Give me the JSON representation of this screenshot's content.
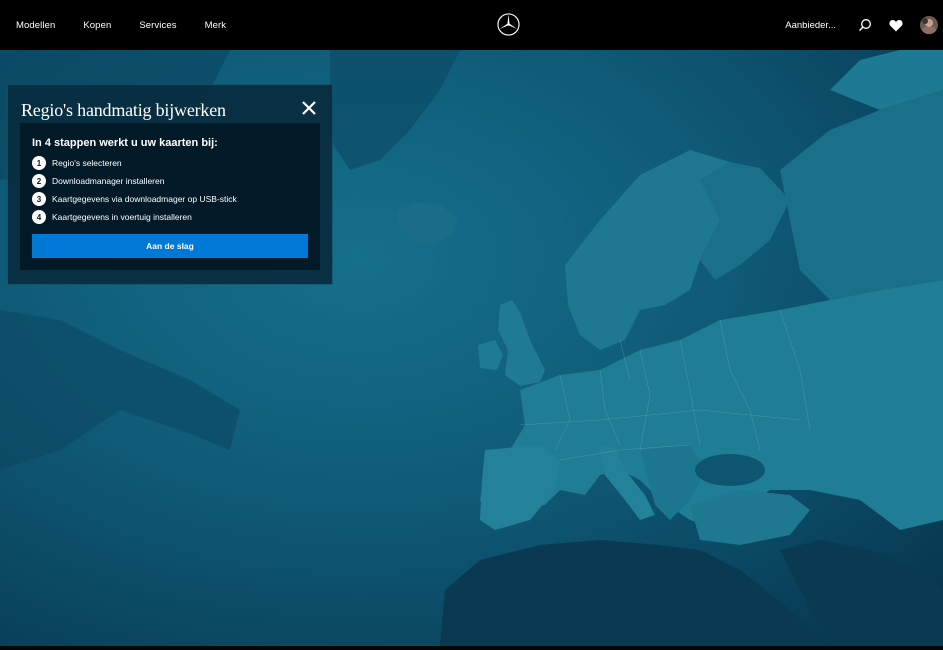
{
  "nav": {
    "items": [
      {
        "label": "Modellen"
      },
      {
        "label": "Kopen"
      },
      {
        "label": "Services"
      },
      {
        "label": "Merk"
      }
    ],
    "dealer_label": "Aanbieder...",
    "icons": [
      "search-icon",
      "heart-icon",
      "avatar"
    ]
  },
  "dialog": {
    "title": "Regio's handmatig bijwerken",
    "heading": "In 4 stappen werkt u uw kaarten bij:",
    "steps": [
      {
        "num": "1",
        "label": "Regio's selecteren"
      },
      {
        "num": "2",
        "label": "Downloadmanager installeren"
      },
      {
        "num": "3",
        "label": "Kaartgegevens via downloadmager op USB-stick"
      },
      {
        "num": "4",
        "label": "Kaartgegevens in voertuig installeren"
      }
    ],
    "cta_label": "Aan de slag"
  },
  "colors": {
    "nav_bg": "#000000",
    "ocean": "#0f5a76",
    "land": "#1d7890",
    "land_dark": "#0a3a52",
    "cta": "#0078d6",
    "dialog_bg": "#092b3e"
  }
}
